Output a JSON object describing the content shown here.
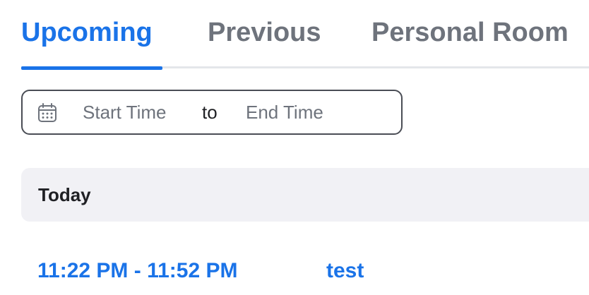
{
  "tabs": [
    {
      "label": "Upcoming",
      "active": true
    },
    {
      "label": "Previous",
      "active": false
    },
    {
      "label": "Personal Room",
      "active": false
    }
  ],
  "date_range": {
    "icon": "calendar-icon",
    "start_placeholder": "Start Time",
    "separator": "to",
    "end_placeholder": "End Time"
  },
  "sections": [
    {
      "title": "Today",
      "meetings": [
        {
          "time": "11:22 PM - 11:52 PM",
          "title": "test"
        }
      ]
    }
  ],
  "colors": {
    "accent": "#1a73e8",
    "inactive_tab": "#6e737c",
    "section_bg": "#f1f1f5",
    "border": "#4a4d55"
  }
}
